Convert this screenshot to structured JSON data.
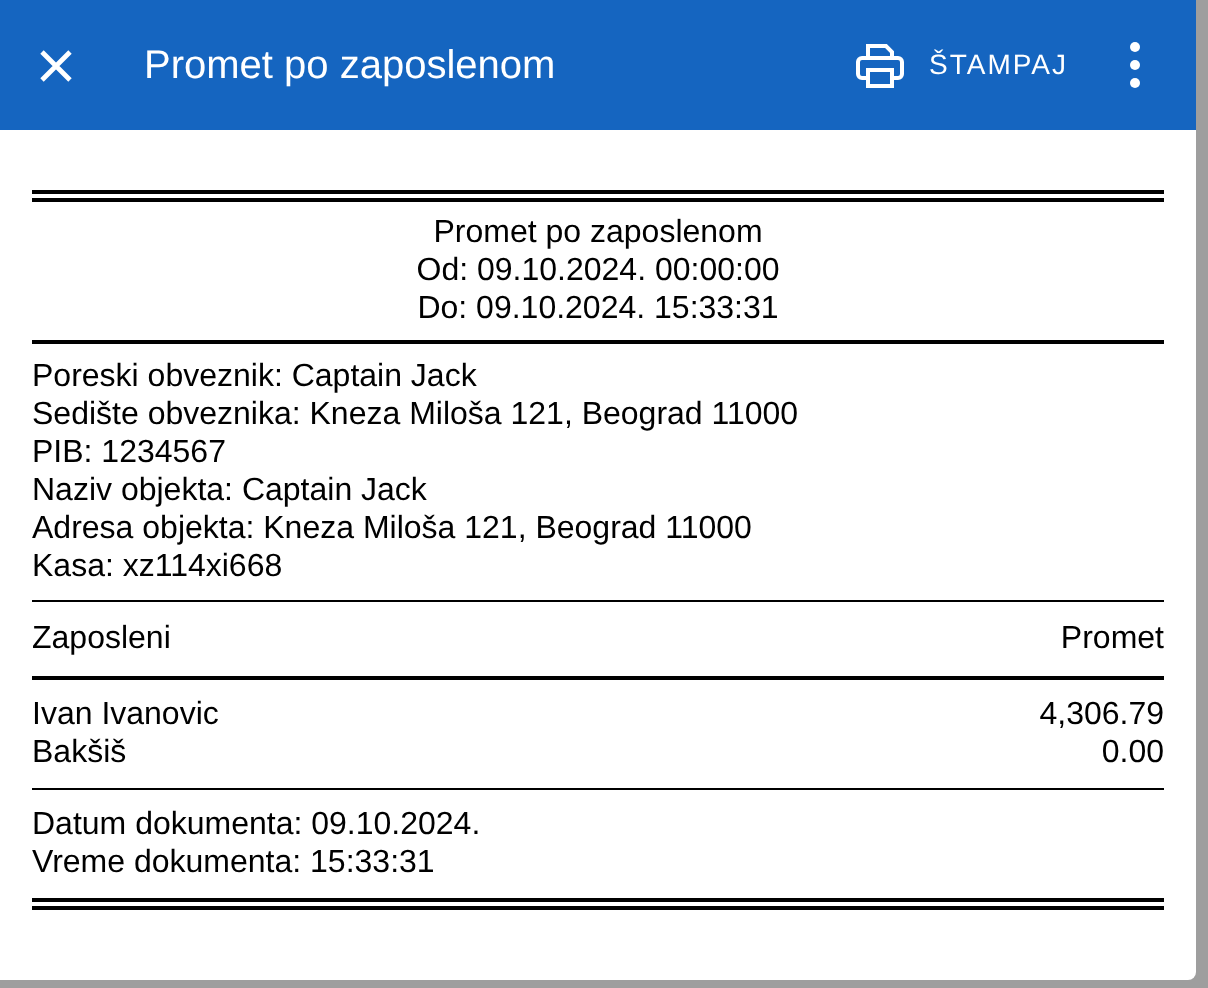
{
  "toolbar": {
    "title": "Promet po zaposlenom",
    "print_label": "ŠTAMPAJ"
  },
  "report": {
    "heading": [
      "Promet po zaposlenom",
      "Od: 09.10.2024. 00:00:00",
      "Do: 09.10.2024. 15:33:31"
    ],
    "info": [
      "Poreski obveznik: Captain Jack",
      "Sedište obveznika: Kneza Miloša 121, Beograd 11000",
      "PIB: 1234567",
      "Naziv objekta: Captain Jack",
      "Adresa objekta: Kneza Miloša 121, Beograd 11000",
      "Kasa: xz114xi668"
    ],
    "columns": [
      "Zaposleni",
      "Promet"
    ],
    "rows": [
      {
        "name": "Ivan Ivanovic",
        "value": "4,306.79"
      },
      {
        "name": "Bakšiš",
        "value": "0.00"
      }
    ],
    "footer": [
      "Datum dokumenta: 09.10.2024.",
      "Vreme dokumenta: 15:33:31"
    ]
  }
}
